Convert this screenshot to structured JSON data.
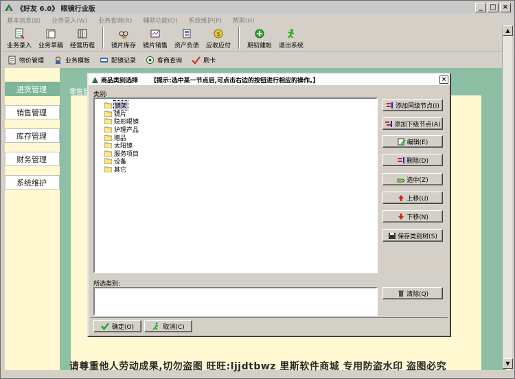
{
  "app": {
    "title": "《好友 6.0》 眼镜行业版",
    "window_buttons": [
      "_",
      "□",
      "×"
    ]
  },
  "menu": [
    "基本信息(B)",
    "业务录入(W)",
    "业务查询(R)",
    "辅助功能(O)",
    "系统维护(P)",
    "帮助(H)"
  ],
  "toolbar1": {
    "group1": [
      {
        "label": "业务录入",
        "icon": "entry-icon"
      },
      {
        "label": "业务草稿",
        "icon": "draft-icon"
      },
      {
        "label": "经营历程",
        "icon": "history-icon"
      }
    ],
    "group2": [
      {
        "label": "镜片库存",
        "icon": "lens-stock-icon"
      },
      {
        "label": "镜片销售",
        "icon": "lens-sales-icon"
      },
      {
        "label": "资产负债",
        "icon": "balance-icon"
      },
      {
        "label": "应收应付",
        "icon": "receivable-icon"
      }
    ],
    "group3": [
      {
        "label": "期初建帐",
        "icon": "opening-account-icon"
      },
      {
        "label": "退出系统",
        "icon": "exit-icon"
      }
    ]
  },
  "toolbar2": [
    {
      "label": "物价管理",
      "icon": "price-icon"
    },
    {
      "label": "业务模板",
      "icon": "template-icon"
    },
    {
      "label": "配镜记录",
      "icon": "record-icon"
    },
    {
      "label": "客商查询",
      "icon": "query-icon"
    },
    {
      "label": "刷卡",
      "icon": "card-icon"
    }
  ],
  "sidebar": [
    {
      "label": "进货管理",
      "active": true
    },
    {
      "label": "销售管理",
      "active": false
    },
    {
      "label": "库存管理",
      "active": false
    },
    {
      "label": "财务管理",
      "active": false
    },
    {
      "label": "系统维护",
      "active": false
    }
  ],
  "content": {
    "tab_label": "零售管"
  },
  "dialog": {
    "title": "商品类别选择",
    "hint": "【提示:选中某一节点后,可点击右边的按钮进行相应的操作。】",
    "category_label": "类别:",
    "categories": [
      "镜架",
      "镜片",
      "隐形眼镜",
      "护理产品",
      "赠品",
      "太阳镜",
      "服务项目",
      "设备",
      "其它"
    ],
    "selected_label": "所选类别:",
    "selected_value": "",
    "buttons": {
      "add_sibling": "添加同级节点(I)",
      "add_child": "添加下级节点(A)",
      "edit": "编辑(E)",
      "delete": "删除(D)",
      "select": "选中(Z)",
      "move_up": "上移(U)",
      "move_down": "下移(N)",
      "save_tree": "保存类别树(S)",
      "clear": "清除(Q)",
      "ok": "确定(O)",
      "cancel": "取消(C)"
    }
  },
  "watermark": "请尊重他人劳动成果,切勿盗图 旺旺:ljjdtbwz 里斯软件商城 专用防盗水印 盗图必究"
}
